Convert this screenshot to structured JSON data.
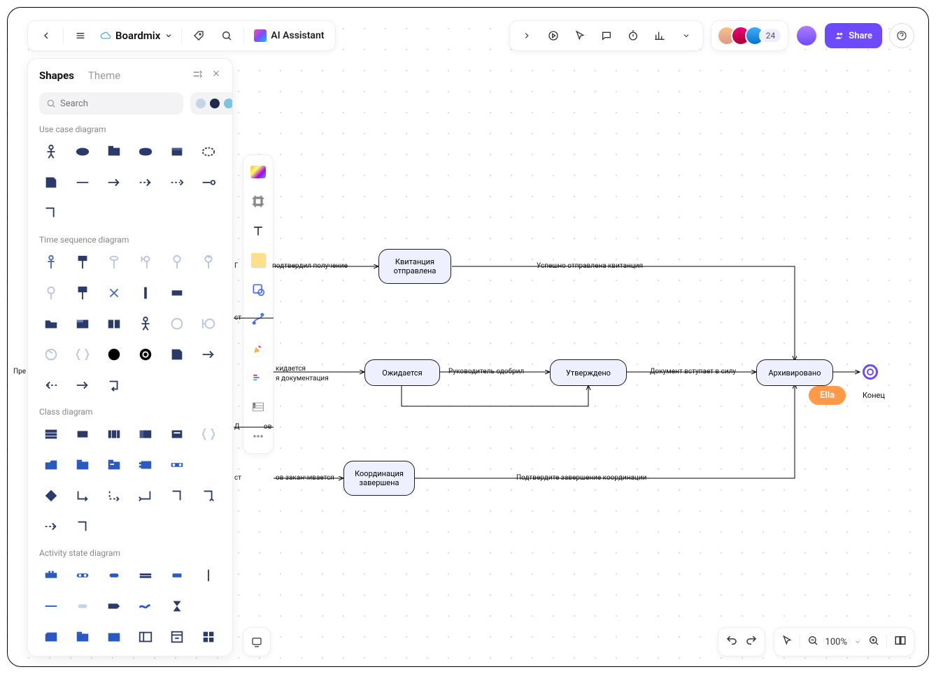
{
  "header": {
    "brand": "Boardmix",
    "ai_label": "AI Assistant",
    "share_label": "Share",
    "avatar_count": "24"
  },
  "panel": {
    "tab_shapes": "Shapes",
    "tab_theme": "Theme",
    "search_placeholder": "Search",
    "colors": [
      "#c5d5e8",
      "#1d2a4d",
      "#7ac6e0",
      "#3a63c9"
    ],
    "sections": [
      "Use case diagram",
      "Time sequence diagram",
      "Class diagram",
      "Activity state diagram"
    ]
  },
  "flow": {
    "nodes": {
      "receipt": "Квитанция отправлена",
      "pending": "Ожидается",
      "approved": "Утверждено",
      "archived": "Архивировано",
      "coord": "Координация завершена"
    },
    "edges": {
      "confirm_receipt": "подтвердил получение",
      "sent_success": "Успешно отправлена квитанция",
      "manager_approved": "Руководитель одобрил",
      "doc_in_force": "Документ вступает в силу",
      "await_docs1": "кидается",
      "await_docs2": "я документация",
      "coord_ends": "ов заканчивается",
      "confirm_coord": "Подтвердите завершение координации",
      "docs_frag": "ов",
      "start_frag": "ст",
      "prev_frag": "Пре",
      "end_label": "Конец"
    },
    "cursor_user": "Ella"
  },
  "zoom": "100%"
}
